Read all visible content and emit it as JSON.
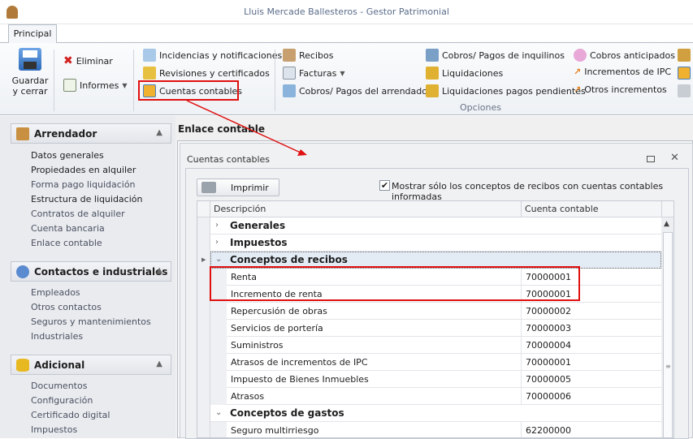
{
  "window": {
    "title": "Lluis Mercade Ballesteros - Gestor Patrimonial"
  },
  "ribbon": {
    "tab": "Principal",
    "save_label_1": "Guardar",
    "save_label_2": "y cerrar",
    "delete": "Eliminar",
    "reports": "Informes",
    "col1": [
      "Incidencias y notificaciones",
      "Revisiones y certificados",
      "Cuentas contables"
    ],
    "col2": [
      "Recibos",
      "Facturas",
      "Cobros/ Pagos del arrendador"
    ],
    "col3": [
      "Cobros/ Pagos de inquilinos",
      "Liquidaciones",
      "Liquidaciones pagos pendientes"
    ],
    "col4": [
      "Cobros anticipados",
      "Incrementos de IPC",
      "Otros incrementos"
    ],
    "group_label": "Opciones"
  },
  "sidebar": {
    "sections": [
      {
        "title": "Arrendador",
        "items": [
          "Datos generales",
          "Propiedades en alquiler",
          "Forma pago liquidación",
          "Estructura de liquidación",
          "Contratos de alquiler",
          "Cuenta bancaria",
          "Enlace contable"
        ]
      },
      {
        "title": "Contactos e industriales",
        "items": [
          "Empleados",
          "Otros contactos",
          "Seguros y mantenimientos",
          "Industriales"
        ]
      },
      {
        "title": "Adicional",
        "items": [
          "Documentos",
          "Configuración",
          "Certificado digital",
          "Impuestos"
        ]
      }
    ]
  },
  "main": {
    "page_title": "Enlace contable",
    "panel_title": "Cuentas contables",
    "print": "Imprimir",
    "filter_checked": true,
    "filter_label": "Mostrar sólo los conceptos de recibos con cuentas contables informadas",
    "columns": [
      "Descripción",
      "Cuenta contable"
    ],
    "rows": [
      {
        "type": "group",
        "expanded": false,
        "label": "Generales",
        "account": ""
      },
      {
        "type": "group",
        "expanded": false,
        "label": "Impuestos",
        "account": ""
      },
      {
        "type": "group",
        "expanded": true,
        "label": "Conceptos de recibos",
        "account": ""
      },
      {
        "type": "item",
        "label": "Renta",
        "account": "70000001"
      },
      {
        "type": "item",
        "label": "Incremento de renta",
        "account": "70000001"
      },
      {
        "type": "item",
        "label": "Repercusión de obras",
        "account": "70000002"
      },
      {
        "type": "item",
        "label": "Servicios de portería",
        "account": "70000003"
      },
      {
        "type": "item",
        "label": "Suministros",
        "account": "70000004"
      },
      {
        "type": "item",
        "label": "Atrasos de incrementos de IPC",
        "account": "70000001"
      },
      {
        "type": "item",
        "label": "Impuesto de Bienes Inmuebles",
        "account": "70000005"
      },
      {
        "type": "item",
        "label": "Atrasos",
        "account": "70000006"
      },
      {
        "type": "group",
        "expanded": true,
        "label": "Conceptos de gastos",
        "account": ""
      },
      {
        "type": "item",
        "label": "Seguro multirriesgo",
        "account": "62200000"
      }
    ]
  }
}
